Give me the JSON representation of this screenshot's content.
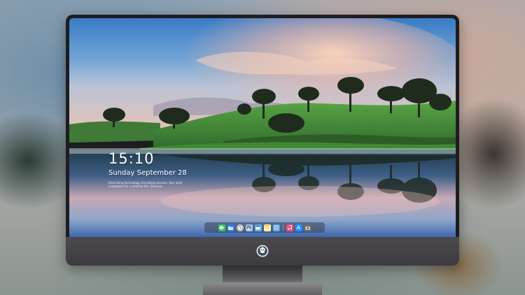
{
  "lock_screen": {
    "time": "15:10",
    "date": "Sunday September 28",
    "caption": "Describing technology. Emulating devices. \nYour local companion for a smarter life. Discover"
  },
  "dock": {
    "items": [
      {
        "icon": "messages-icon",
        "color": "#34c759"
      },
      {
        "icon": "files-icon",
        "color": "#2f7de1"
      },
      {
        "icon": "clock-icon",
        "color": "#d9d9d9"
      },
      {
        "icon": "photos-icon",
        "color": "#8fb6d9"
      },
      {
        "icon": "video-icon",
        "color": "#56b2e8"
      },
      {
        "icon": "notes-icon",
        "color": "#f6e27a"
      },
      {
        "icon": "gallery-icon",
        "color": "#5aa3e0"
      },
      {
        "icon": "music-icon",
        "color": "#f04d7d"
      },
      {
        "icon": "appstore-icon",
        "color": "#1e90ff"
      },
      {
        "icon": "camera-icon",
        "color": "#6b6b6f"
      }
    ]
  },
  "colors": {
    "bezel": "#1d1d20",
    "chin": "#4c4a4f",
    "sky_top": "#3f80c8",
    "cloud_glow": "#f2b7a0",
    "hills": "#4f9a3e"
  }
}
